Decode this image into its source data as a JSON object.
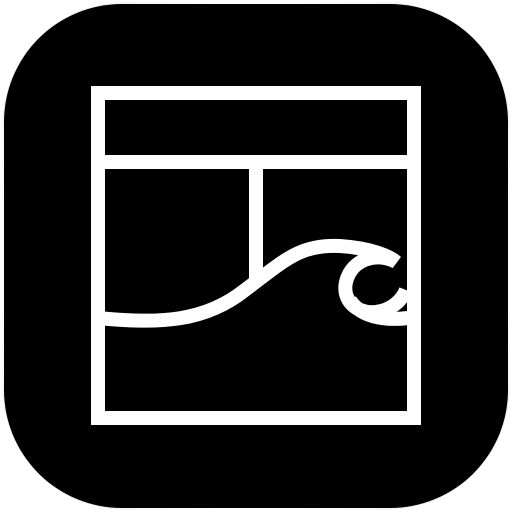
{
  "app_icon": {
    "icon_name": "layout-wave-icon",
    "background_color": "#000000",
    "stroke_color": "#ffffff"
  }
}
